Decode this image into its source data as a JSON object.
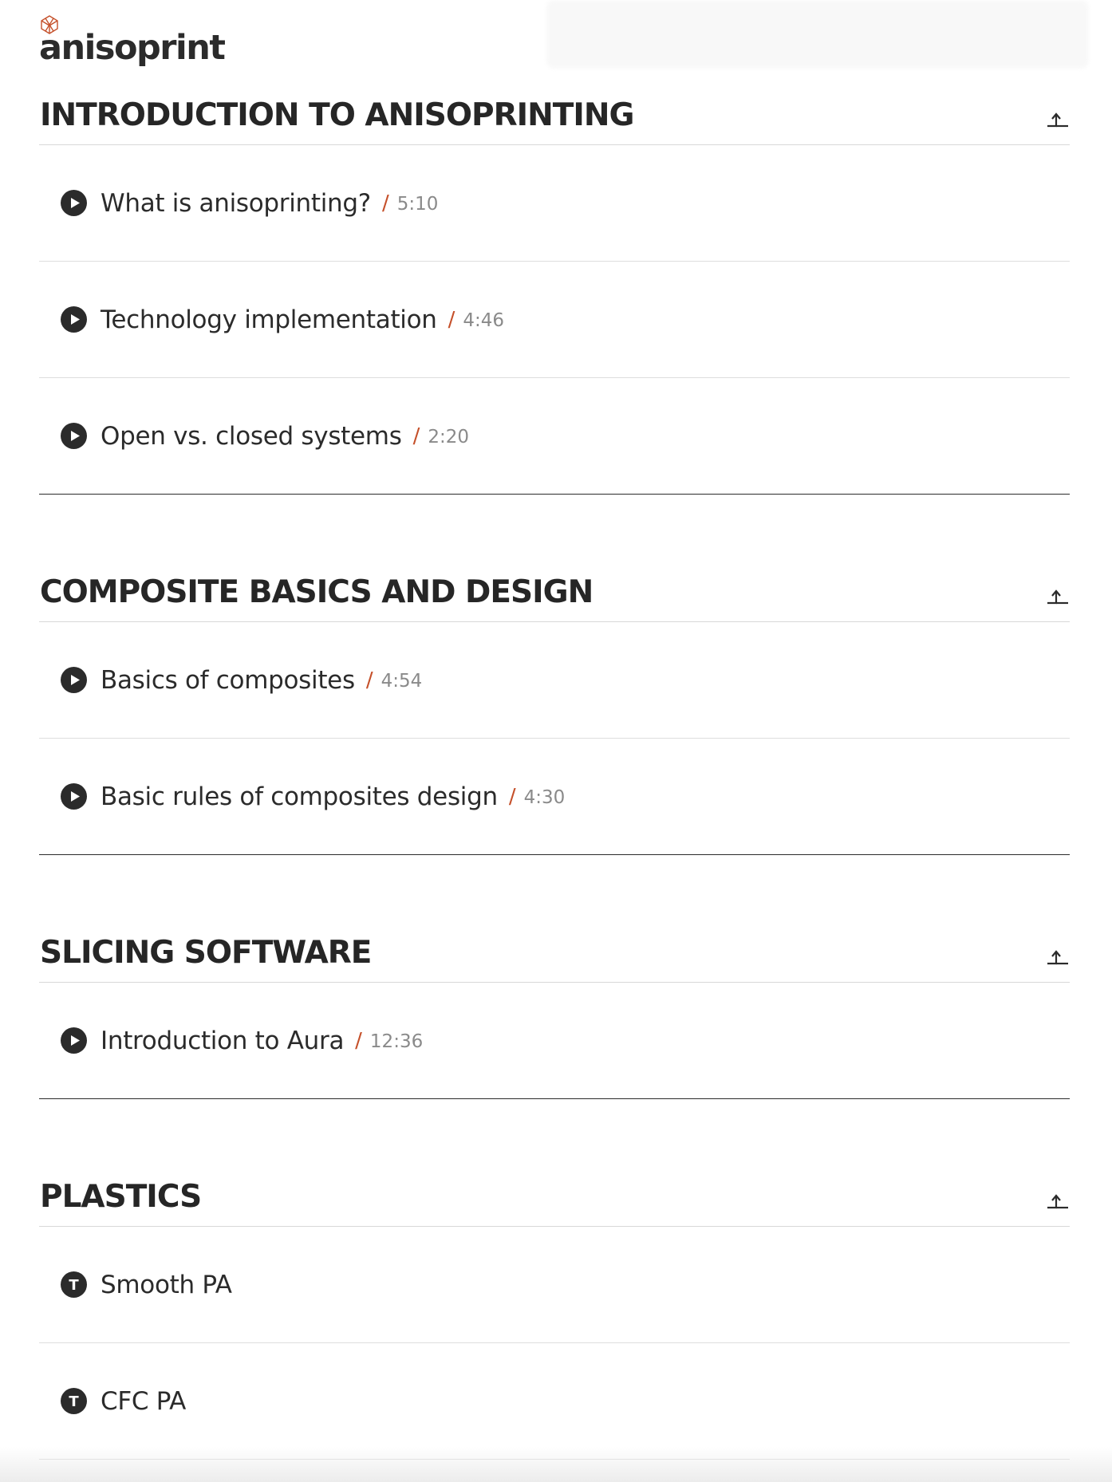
{
  "brand": {
    "logo_text": "anisoprint",
    "accent_color": "#c5502a"
  },
  "sections": [
    {
      "title": "INTRODUCTION TO ANISOPRINTING",
      "items": [
        {
          "title": "What is anisoprinting?",
          "duration": "5:10",
          "icon": "play-icon"
        },
        {
          "title": "Technology implementation",
          "duration": "4:46",
          "icon": "play-icon"
        },
        {
          "title": "Open vs. closed systems",
          "duration": "2:20",
          "icon": "play-icon"
        }
      ]
    },
    {
      "title": "COMPOSITE BASICS AND DESIGN",
      "items": [
        {
          "title": "Basics of composites",
          "duration": "4:54",
          "icon": "play-icon"
        },
        {
          "title": "Basic rules of composites design",
          "duration": "4:30",
          "icon": "play-icon"
        }
      ]
    },
    {
      "title": "SLICING SOFTWARE",
      "items": [
        {
          "title": "Introduction to Aura",
          "duration": "12:36",
          "icon": "play-icon"
        }
      ]
    },
    {
      "title": "PLASTICS",
      "items": [
        {
          "title": "Smooth PA",
          "icon": "text-icon",
          "icon_letter": "T"
        },
        {
          "title": "CFC PA",
          "icon": "text-icon",
          "icon_letter": "T"
        }
      ]
    }
  ],
  "ui": {
    "duration_separator": "/"
  }
}
